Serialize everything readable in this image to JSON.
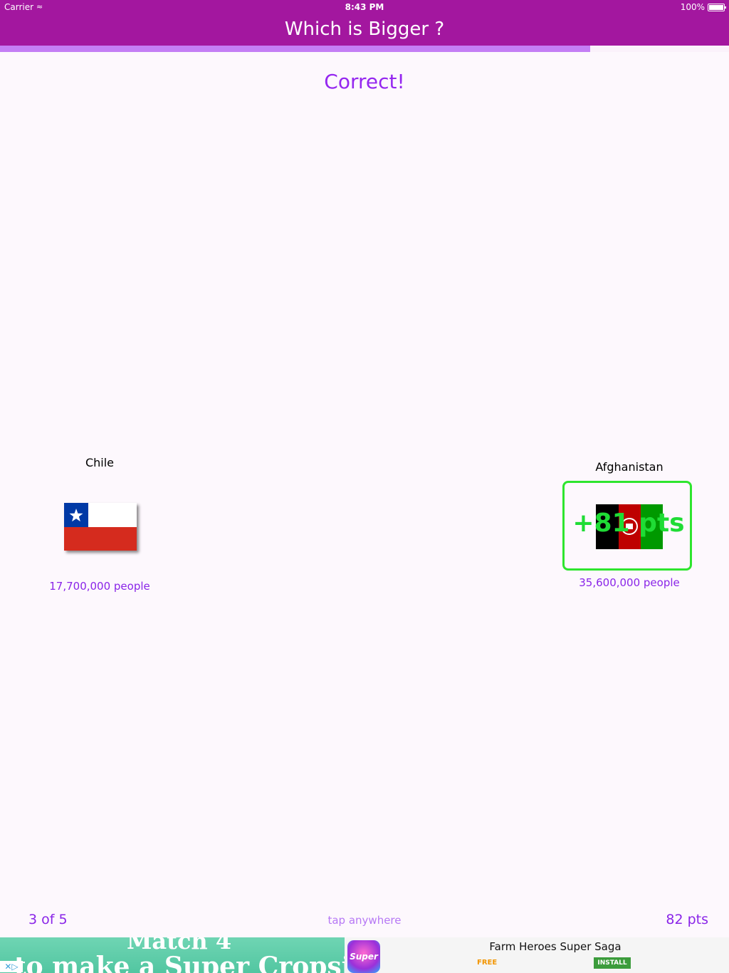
{
  "status_bar": {
    "carrier": "Carrier",
    "time": "8:43 PM",
    "battery": "100%"
  },
  "nav": {
    "title": "Which is Bigger ?"
  },
  "progress": {
    "fraction": 0.81
  },
  "result": {
    "text": "Correct!"
  },
  "left_country": {
    "name": "Chile",
    "population": "17,700,000 people",
    "flag_icon": "chile-flag-icon"
  },
  "right_country": {
    "name": "Afghanistan",
    "population": "35,600,000 people",
    "flag_icon": "afghanistan-flag-icon",
    "award": "+81 pts",
    "highlight_color": "#2ee52e"
  },
  "footer": {
    "question_count": "3 of 5",
    "hint": "tap anywhere",
    "score": "82 pts"
  },
  "ad": {
    "creative_line1": "Match 4",
    "creative_line2": "to make a Super Cropsie",
    "app_icon_label": "Super",
    "title": "Farm Heroes Super Saga",
    "price": "FREE",
    "install": "INSTALL"
  },
  "colors": {
    "accent": "#a3179f",
    "text_purple": "#8a25e8",
    "country_red": "#ec4b4b"
  }
}
